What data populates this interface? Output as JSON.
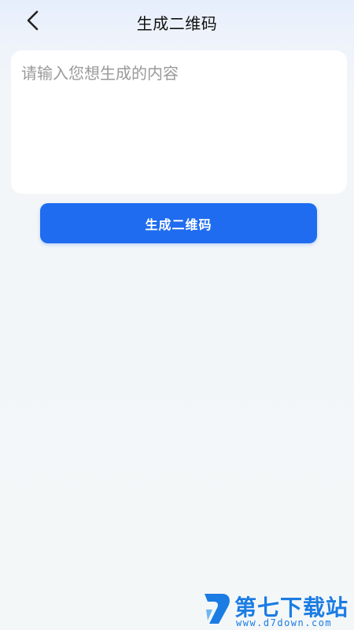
{
  "header": {
    "title": "生成二维码",
    "back_icon": "chevron-left-icon"
  },
  "input": {
    "placeholder": "请输入您想生成的内容",
    "value": ""
  },
  "actions": {
    "generate_label": "生成二维码"
  },
  "watermark": {
    "name": "第七下载站",
    "url": "www.d7down.com"
  },
  "colors": {
    "accent": "#1f6cf0",
    "watermark": "#1b7ce3",
    "background": "#f4f7f8"
  }
}
